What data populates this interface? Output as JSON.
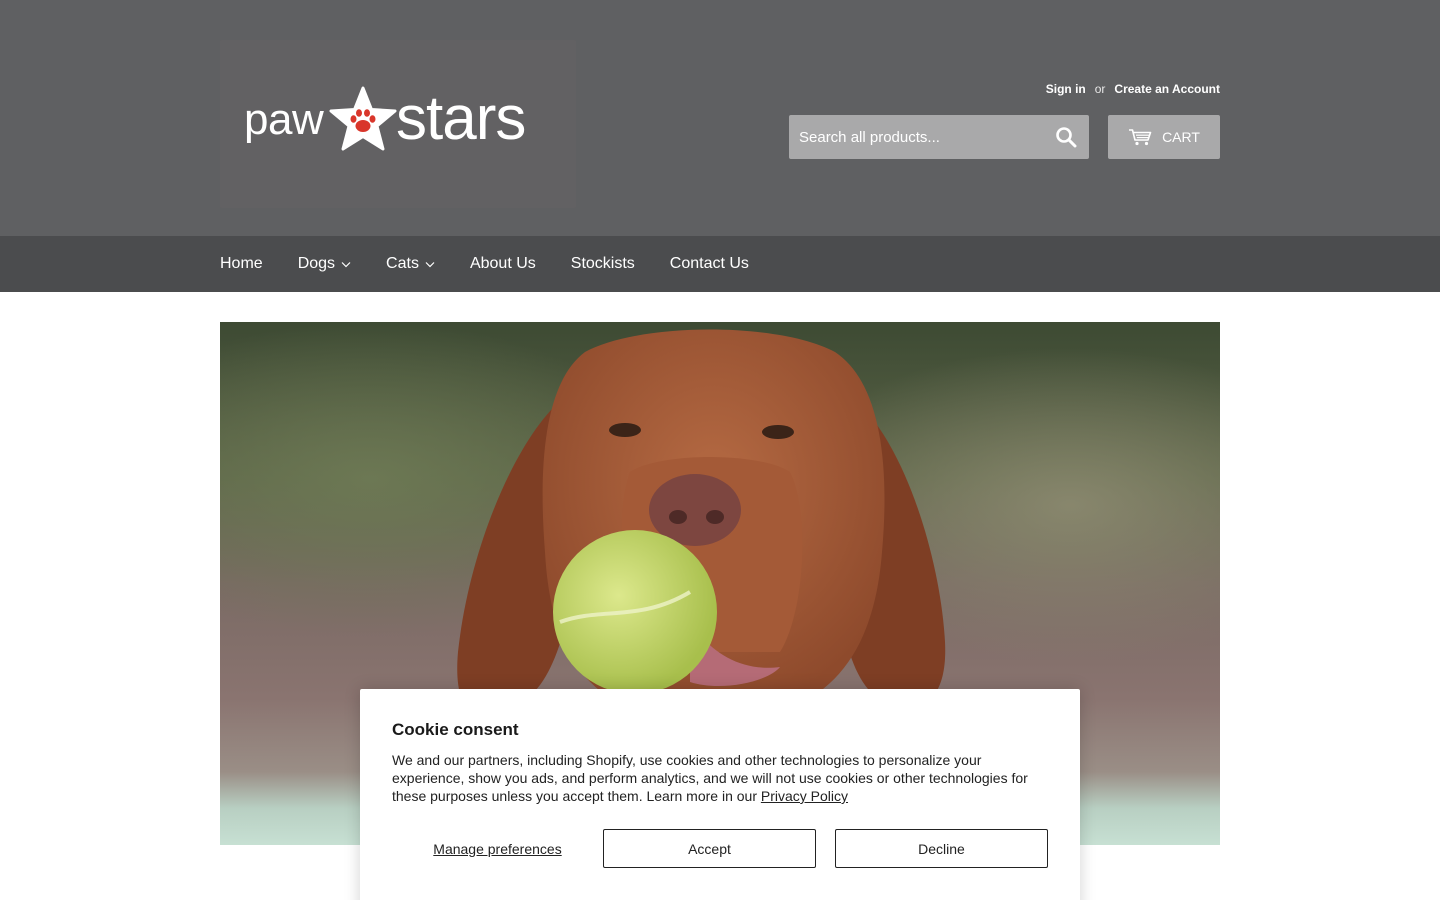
{
  "header": {
    "logo": {
      "word_left": "paw",
      "word_right": "stars",
      "icon": "star-paw-icon"
    },
    "account": {
      "sign_in": "Sign in",
      "separator": "or",
      "create_account": "Create an Account"
    },
    "search": {
      "placeholder": "Search all products...",
      "icon": "search-icon"
    },
    "cart": {
      "label": "CART",
      "icon": "cart-icon"
    }
  },
  "nav": {
    "items": [
      {
        "label": "Home",
        "has_dropdown": false
      },
      {
        "label": "Dogs",
        "has_dropdown": true
      },
      {
        "label": "Cats",
        "has_dropdown": true
      },
      {
        "label": "About Us",
        "has_dropdown": false
      },
      {
        "label": "Stockists",
        "has_dropdown": false
      },
      {
        "label": "Contact Us",
        "has_dropdown": false
      }
    ]
  },
  "hero": {
    "image": "dog-with-tennis-ball"
  },
  "cookie": {
    "title": "Cookie consent",
    "body": "We and our partners, including Shopify, use cookies and other technologies to personalize your experience, show you ads, and perform analytics, and we will not use cookies or other technologies for these purposes unless you accept them. Learn more in our ",
    "policy_link": "Privacy Policy",
    "manage": "Manage preferences",
    "accept": "Accept",
    "decline": "Decline"
  },
  "colors": {
    "header_bg": "#5f6062",
    "nav_bg": "#4b4c4e",
    "button_bg": "#a9a9aa",
    "logo_paw": "#d9362b"
  }
}
